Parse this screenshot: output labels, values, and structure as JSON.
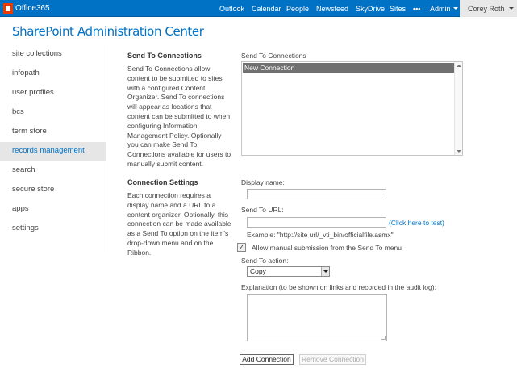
{
  "topbar": {
    "brand": "Office365",
    "nav": [
      "Outlook",
      "Calendar",
      "People",
      "Newsfeed",
      "SkyDrive",
      "Sites"
    ],
    "more": "•••",
    "admin": "Admin",
    "user": "Corey Roth"
  },
  "page_title": "SharePoint Administration Center",
  "sidebar": {
    "items": [
      {
        "label": "site collections"
      },
      {
        "label": "infopath"
      },
      {
        "label": "user profiles"
      },
      {
        "label": "bcs"
      },
      {
        "label": "term store"
      },
      {
        "label": "records management"
      },
      {
        "label": "search"
      },
      {
        "label": "secure store"
      },
      {
        "label": "apps"
      },
      {
        "label": "settings"
      }
    ],
    "active": "records management"
  },
  "send_to": {
    "heading": "Send To Connections",
    "description": "Send To Connections allow content to be submitted to sites with a configured Content Organizer. Send To connections will appear as locations that content can be submitted to when configuring Information Management Policy. Optionally you can make Send To Connections available for users to manually submit content.",
    "list_label": "Send To Connections",
    "list_items": [
      "New Connection"
    ]
  },
  "connection_settings": {
    "heading": "Connection Settings",
    "description": "Each connection requires a display name and a URL to a content organizer. Optionally, this connection can be made available as a Send To option on the item's drop-down menu and on the Ribbon.",
    "display_name_label": "Display name:",
    "display_name_value": "",
    "url_label": "Send To URL:",
    "url_value": "",
    "test_link": "(Click here to test)",
    "example": "Example: \"http://site url/_vti_bin/officialfile.asmx\"",
    "manual_label": "Allow manual submission from the Send To menu",
    "manual_checked": true,
    "action_label": "Send To action:",
    "action_value": "Copy",
    "explanation_label": "Explanation (to be shown on links and recorded in the audit log):",
    "explanation_value": ""
  },
  "buttons": {
    "add": "Add Connection",
    "remove": "Remove Connection"
  }
}
